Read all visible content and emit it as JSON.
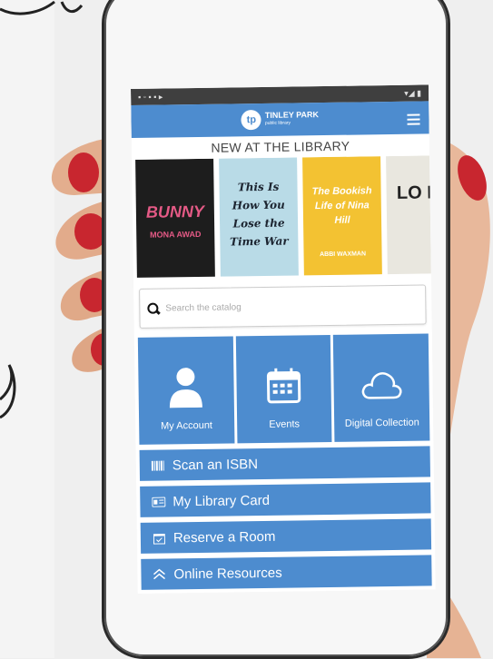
{
  "header": {
    "logo_mark": "tp",
    "logo_text": "TINLEY PARK",
    "logo_sub": "public library"
  },
  "section": {
    "new_at_library": "NEW AT THE LIBRARY"
  },
  "books": [
    {
      "title": "BUNNY",
      "subtitle": "MONA AWAD",
      "bg": "#1d1d1d",
      "fg": "#e55a86"
    },
    {
      "title": "This Is How You Lose the Time War",
      "subtitle": "",
      "bg": "#b9dbe7",
      "fg": "#1c2430"
    },
    {
      "title": "The Bookish Life of Nina Hill",
      "subtitle": "ABBI WAXMAN",
      "bg": "#f3c232",
      "fg": "#ffffff"
    },
    {
      "title": "LO BO",
      "subtitle": "",
      "bg": "#e9e7df",
      "fg": "#222222"
    }
  ],
  "search": {
    "placeholder": "Search the catalog"
  },
  "tiles": [
    {
      "label": "My Account",
      "icon": "user-icon"
    },
    {
      "label": "Events",
      "icon": "calendar-icon"
    },
    {
      "label": "Digital Collection",
      "icon": "cloud-icon"
    }
  ],
  "buttons": [
    {
      "label": "Scan an ISBN",
      "icon": "barcode-icon"
    },
    {
      "label": "My Library Card",
      "icon": "card-icon"
    },
    {
      "label": "Reserve a Room",
      "icon": "calendar-check-icon"
    },
    {
      "label": "Online Resources",
      "icon": "chevron-up-icon"
    }
  ],
  "colors": {
    "accent": "#4d8ccf",
    "nail": "#c8262f"
  }
}
